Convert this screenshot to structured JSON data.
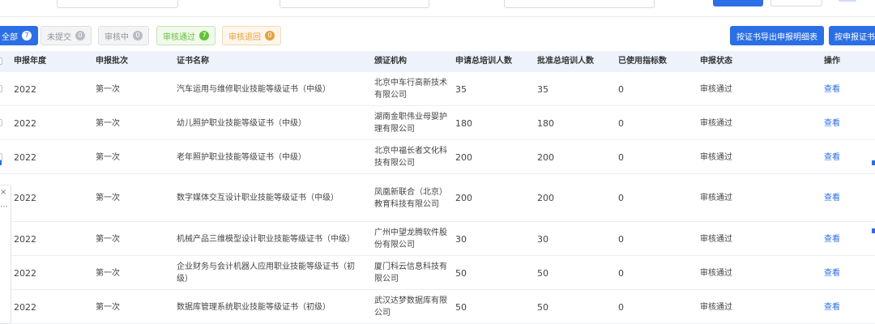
{
  "filters": [
    {
      "label": "全部",
      "count": "7",
      "kind": "all"
    },
    {
      "label": "未提交",
      "count": "0",
      "kind": "draft"
    },
    {
      "label": "审核中",
      "count": "0",
      "kind": "review"
    },
    {
      "label": "审核通过",
      "count": "7",
      "kind": "pass"
    },
    {
      "label": "审核退回",
      "count": "0",
      "kind": "back"
    }
  ],
  "toolbar": {
    "export_detail_label": "按证书导出申报明细表",
    "export_cert_label": "按申报证书试"
  },
  "colors": {
    "primary": "#2b6fe6",
    "pass": "#67c23a",
    "back": "#e6a23c",
    "header_bg": "#eef3fb"
  },
  "table": {
    "headers": [
      "申报年度",
      "申报批次",
      "证书名称",
      "颁证机构",
      "申请总培训人数",
      "批准总培训人数",
      "已使用指标数",
      "申报状态",
      "操作"
    ],
    "rows": [
      {
        "year": "2022",
        "batch": "第一次",
        "cert": "汽车运用与维修职业技能等级证书（中级）",
        "org": "北京中车行高新技术有限公司",
        "applied": "35",
        "approved": "35",
        "used": "0",
        "status": "审核通过",
        "action": "查看"
      },
      {
        "year": "2022",
        "batch": "第一次",
        "cert": "幼儿照护职业技能等级证书（中级）",
        "org": "湖南金职伟业母婴护理有限公司",
        "applied": "180",
        "approved": "180",
        "used": "0",
        "status": "审核通过",
        "action": "查看"
      },
      {
        "year": "2022",
        "batch": "第一次",
        "cert": "老年照护职业技能等级证书（中级）",
        "org": "北京中福长者文化科技有限公司",
        "applied": "200",
        "approved": "200",
        "used": "0",
        "status": "审核通过",
        "action": "查看"
      },
      {
        "year": "2022",
        "batch": "第一次",
        "cert": "数字媒体交互设计职业技能等级证书（中级）",
        "org": "凤凰新联合（北京）教育科技有限公司",
        "applied": "200",
        "approved": "200",
        "used": "0",
        "status": "审核通过",
        "action": "查看"
      },
      {
        "year": "2022",
        "batch": "第一次",
        "cert": "机械产品三维模型设计职业技能等级证书（中级）",
        "org": "广州中望龙腾软件股份有限公司",
        "applied": "30",
        "approved": "30",
        "used": "0",
        "status": "审核通过",
        "action": "查看"
      },
      {
        "year": "2022",
        "batch": "第一次",
        "cert": "企业财务与会计机器人应用职业技能等级证书（初级）",
        "org": "厦门科云信息科技有限公司",
        "applied": "50",
        "approved": "50",
        "used": "0",
        "status": "审核通过",
        "action": "查看"
      },
      {
        "year": "2022",
        "batch": "第一次",
        "cert": "数据库管理系统职业技能等级证书（初级）",
        "org": "武汉达梦数据库有限公司",
        "applied": "50",
        "approved": "50",
        "used": "0",
        "status": "审核通过",
        "action": "查看"
      }
    ]
  },
  "side_panel": {
    "close_glyph": "×",
    "more_glyph": "⋯"
  }
}
